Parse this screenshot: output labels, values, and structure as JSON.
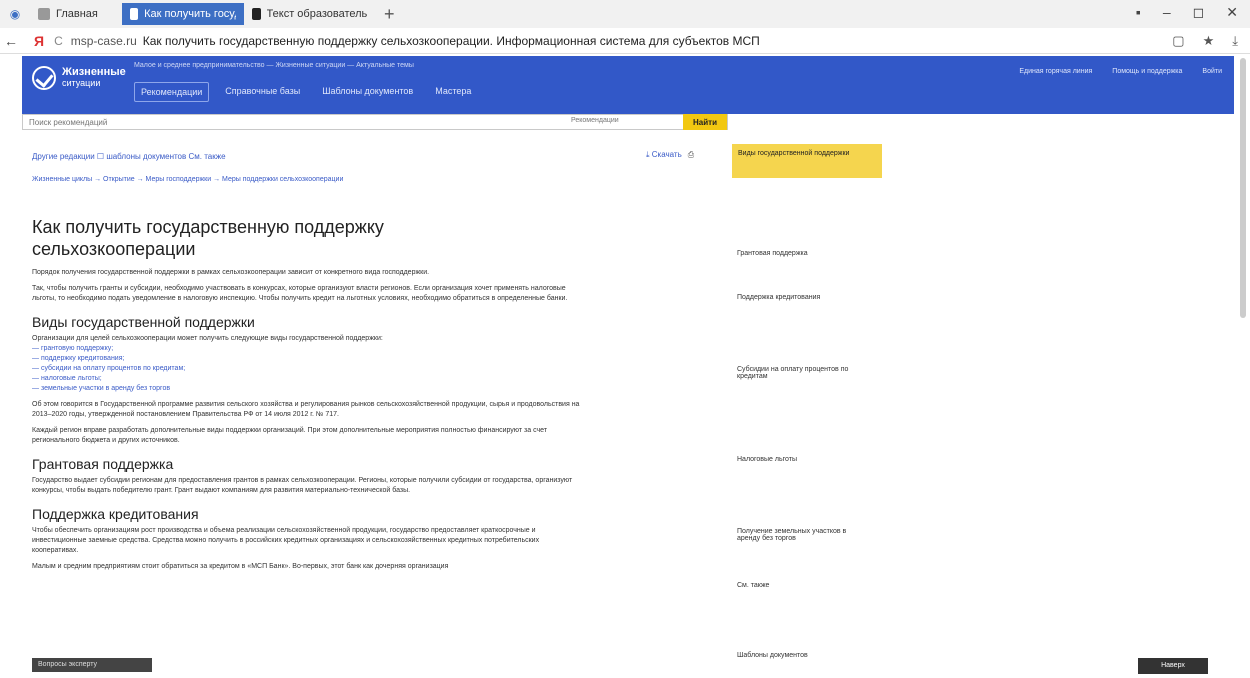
{
  "browser": {
    "tabs": [
      {
        "label": "Главная"
      },
      {
        "label": "Как получить государств…"
      },
      {
        "label": "Текст образовательного с…"
      }
    ],
    "new_tab": "+",
    "window_controls": [
      "▪",
      "–",
      "◻",
      "✕"
    ],
    "address": {
      "back": "←",
      "logo": "Я",
      "reload": "C",
      "host": "msp-case.ru",
      "title": "Как получить государственную поддержку сельхозкооперации. Информационная система для субъектов МСП",
      "right_icons": [
        "▢",
        "★",
        "⤓"
      ]
    }
  },
  "site": {
    "logo_line1": "Жизненные",
    "logo_line2": "ситуации",
    "header_crumbs": "Малое и среднее предпринимательство — Жизненные ситуации — Актуальные темы",
    "nav": [
      "Рекомендации",
      "Справочные базы",
      "Шаблоны документов",
      "Мастера"
    ],
    "header_right": [
      "Единая горячая линия",
      "Помощь и поддержка",
      "Войти"
    ]
  },
  "search": {
    "placeholder": "Поиск рекомендаций",
    "select": "Рекомендации",
    "button": "Найти"
  },
  "content": {
    "links_row": "Другие редакции  ☐ шаблоны документов  См. также",
    "download": "⤓ Скачать",
    "print_icon": "⎙",
    "breadcrumb": "Жизненные циклы → Открытие → Меры господдержки → Меры поддержки сельхозкооперации",
    "h1": "Как получить государственную поддержку сельхозкооперации",
    "p1": "Порядок получения государственной поддержки в рамках сельхозкооперации зависит от конкретного вида господдержки.",
    "p2": "Так, чтобы получить гранты и субсидии, необходимо участвовать в конкурсах, которые организуют власти регионов. Если организация хочет применять налоговые льготы, то необходимо подать уведомление в налоговую инспекцию. Чтобы получить кредит на льготных условиях, необходимо обратиться в определенные банки.",
    "h2_1": "Виды государственной поддержки",
    "p3": "Организации для целей сельхозкооперации может получить следующие виды государственной поддержки:",
    "list": [
      "— грантовую поддержку;",
      "— поддержку кредитования;",
      "— субсидии на оплату процентов по кредитам;",
      "— налоговые льготы;",
      "— земельные участки в аренду без торгов"
    ],
    "p4": "Об этом говорится в Государственной программе развития сельского хозяйства и регулирования рынков сельскохозяйственной продукции, сырья и продовольствия на 2013–2020 годы, утвержденной постановлением Правительства РФ от 14 июля 2012 г. № 717.",
    "p5": "Каждый регион вправе разработать дополнительные виды поддержки организаций. При этом дополнительные мероприятия полностью финансируют за счет регионального бюджета и других источников.",
    "h2_2": "Грантовая поддержка",
    "p6": "Государство выдает субсидии регионам для предоставления грантов в рамках сельхозкооперации. Регионы, которые получили субсидии от государства, организуют конкурсы, чтобы выдать победителю грант. Грант выдают компаниям для развития материально-технической базы.",
    "h2_3": "Поддержка кредитования",
    "p7": "Чтобы обеспечить организациям рост производства и объема реализации сельскохозяйственной продукции, государство предоставляет краткосрочные и инвестиционные заемные средства. Средства можно получить в российских кредитных организациях и сельскохозяйственных кредитных потребительских кооперативах.",
    "p8": "Малым и средним предприятиям стоит обратиться за кредитом в «МСП Банк». Во-первых, этот банк как дочерняя организация"
  },
  "sidebar": {
    "active": "Виды государственной поддержки",
    "items": [
      "Грантовая поддержка",
      "Поддержка кредитования",
      "Субсидии на оплату процентов по кредитам",
      "Налоговые льготы",
      "Получение земельных участков в аренду без торгов",
      "См. также",
      "Шаблоны документов"
    ]
  },
  "overlays": {
    "toast": "Вопросы эксперту",
    "fab": "Наверх"
  }
}
